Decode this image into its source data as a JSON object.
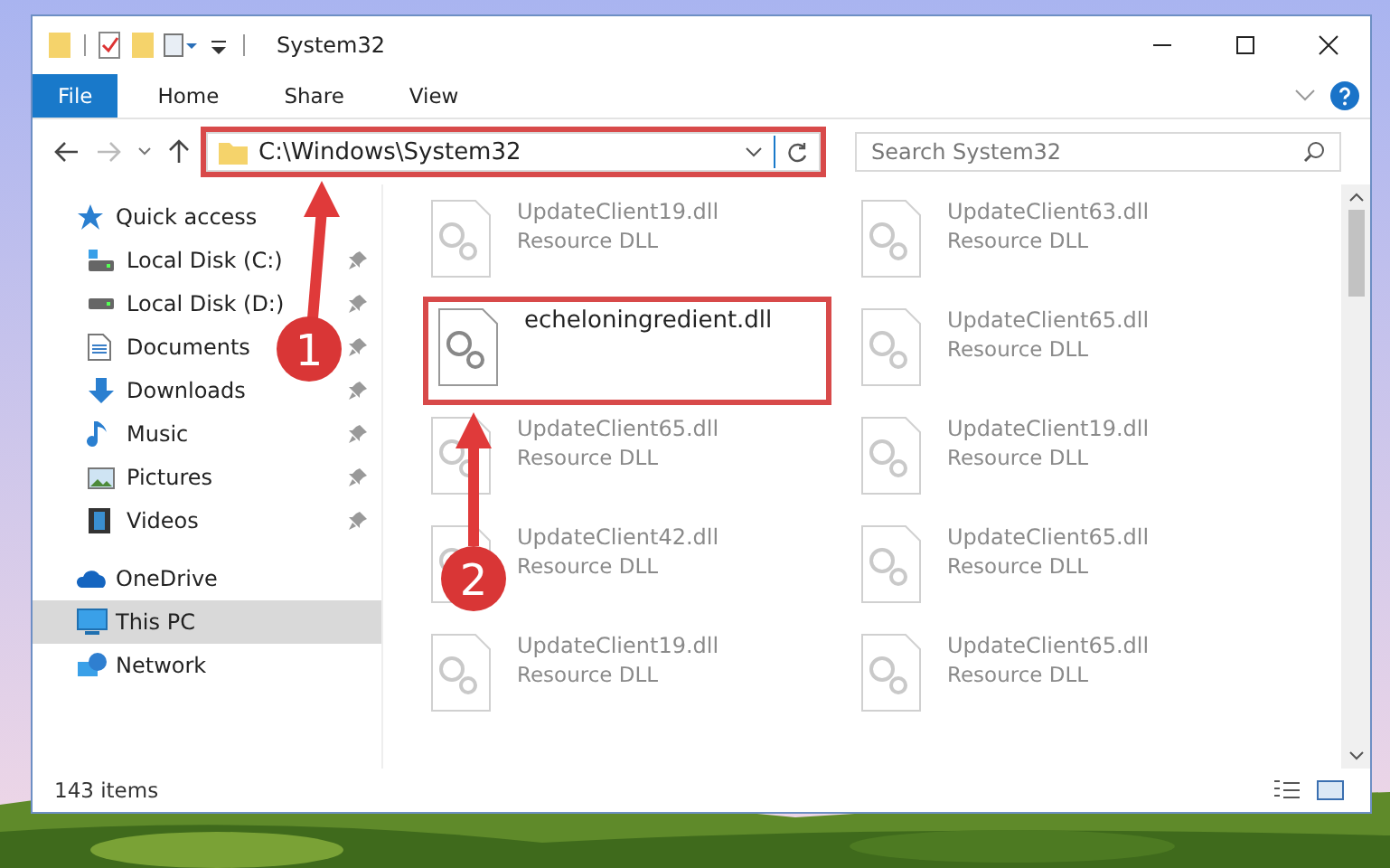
{
  "window": {
    "title": "System32"
  },
  "ribbon": {
    "tabs": [
      {
        "label": "File",
        "selected": true
      },
      {
        "label": "Home",
        "selected": false
      },
      {
        "label": "Share",
        "selected": false
      },
      {
        "label": "View",
        "selected": false
      }
    ]
  },
  "address_bar": {
    "path": "C:\\Windows\\System32",
    "highlighted": true
  },
  "search": {
    "placeholder": "Search System32"
  },
  "sidebar": {
    "items": [
      {
        "label": "Quick access",
        "selected": false,
        "children": [
          {
            "label": "Local Disk (C:)",
            "pinned": true
          },
          {
            "label": "Local Disk (D:)",
            "pinned": true
          },
          {
            "label": "Documents",
            "pinned": true
          },
          {
            "label": "Downloads",
            "pinned": true
          },
          {
            "label": "Music",
            "pinned": true
          },
          {
            "label": "Pictures",
            "pinned": true
          },
          {
            "label": "Videos",
            "pinned": true
          }
        ]
      },
      {
        "label": "OneDrive",
        "selected": false
      },
      {
        "label": "This PC",
        "selected": true
      },
      {
        "label": "Network",
        "selected": false
      }
    ]
  },
  "files": [
    {
      "name": "UpdateClient19.dll",
      "type": "Resource DLL",
      "blurred": true,
      "highlighted": false
    },
    {
      "name": "UpdateClient63.dll",
      "type": "Resource DLL",
      "blurred": true,
      "highlighted": false
    },
    {
      "name": "echeloningredient.dll",
      "blurred": false,
      "highlighted": true
    },
    {
      "name": "UpdateClient65.dll",
      "type": "Resource DLL",
      "blurred": true,
      "highlighted": false
    },
    {
      "name": "UpdateClient65.dll",
      "type": "Resource DLL",
      "blurred": true,
      "highlighted": false
    },
    {
      "name": "UpdateClient19.dll",
      "type": "Resource DLL",
      "blurred": true,
      "highlighted": false
    },
    {
      "name": "UpdateClient42.dll",
      "type": "Resource DLL",
      "blurred": true,
      "highlighted": false
    },
    {
      "name": "UpdateClient65.dll",
      "type": "Resource DLL",
      "blurred": true,
      "highlighted": false
    },
    {
      "name": "UpdateClient19.dll",
      "type": "Resource DLL",
      "blurred": true,
      "highlighted": false
    },
    {
      "name": "UpdateClient65.dll",
      "type": "Resource DLL",
      "blurred": true,
      "highlighted": false
    }
  ],
  "status_bar": {
    "item_count": "143 items"
  },
  "callouts": [
    {
      "number": "1"
    },
    {
      "number": "2"
    }
  ]
}
